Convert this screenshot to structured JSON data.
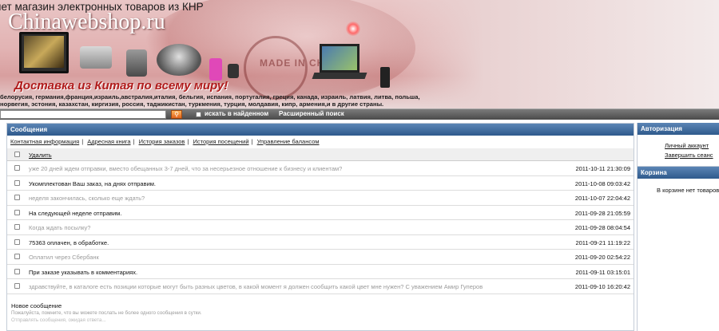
{
  "banner": {
    "tagline": "нет магазин электронных товаров из КНР",
    "site_name": "Chinawebshop.ru",
    "slogan": "Доставка из Китая по всему миру!",
    "countries_line1": "белорусия, германия,франция,израиль,австралия,италия, бельгия, испания, португалия, греция, канада, израиль, латвия, литва, польша,",
    "countries_line2": "норвегия, эстония, казахстан, киргизия, россия, таджикистан, туркмения, турция, молдавия, кипр, армения,и в другие страны.",
    "stamp_text": "MADE IN CHINA"
  },
  "search": {
    "value": "",
    "button_icon": "search-icon",
    "found_label": "искать в найденном",
    "advanced_label": "Расширенный поиск"
  },
  "messages": {
    "title": "Сообщения",
    "links": [
      "Контактная информация",
      "Адресная книга",
      "История заказов",
      "История посещений",
      "Управление балансом"
    ],
    "delete_label": "Удалить",
    "rows": [
      {
        "text": "уже 20 дней ждем отправки, вместо обещанных 3-7 дней, что за несерьезное отношение к бизнесу и клиентам?",
        "date": "2011-10-11 21:30:09",
        "read": true
      },
      {
        "text": "Укомплектован Ваш заказ, на днях отправим.",
        "date": "2011-10-08 09:03:42",
        "read": false
      },
      {
        "text": "неделя закончилась, сколько еще ждать?",
        "date": "2011-10-07 22:04:42",
        "read": true
      },
      {
        "text": "На следующей неделе отправим.",
        "date": "2011-09-28 21:05:59",
        "read": false
      },
      {
        "text": "Когда ждать посылку?",
        "date": "2011-09-28 08:04:54",
        "read": true
      },
      {
        "text": "75363 оплачен, в обработке.",
        "date": "2011-09-21 11:19:22",
        "read": false
      },
      {
        "text": "Оплатил через Сбербанк",
        "date": "2011-09-20 02:54:22",
        "read": true
      },
      {
        "text": "При заказе указывать в комментариях.",
        "date": "2011-09-11 03:15:01",
        "read": false
      },
      {
        "text": "здравствуйте, в каталоге есть позиции которые могут быть разных цветов, в какой момент я должен сообщить какой цвет мне нужен? С уважением Амир Гуперов",
        "date": "2011-09-10 16:20:42",
        "read": true
      }
    ],
    "new_message_label": "Новое сообщение",
    "note1": "Пожалуйста, помните, что вы можете послать не более одного сообщения в сутки.",
    "note2": "Отправлять сообщения, ожидая ответа..."
  },
  "auth": {
    "title": "Авторизация",
    "account_link": "Личный аккаунт",
    "logout_link": "Завершить сеанс"
  },
  "cart": {
    "title": "Корзина",
    "empty_text": "В корзине нет товаров"
  }
}
